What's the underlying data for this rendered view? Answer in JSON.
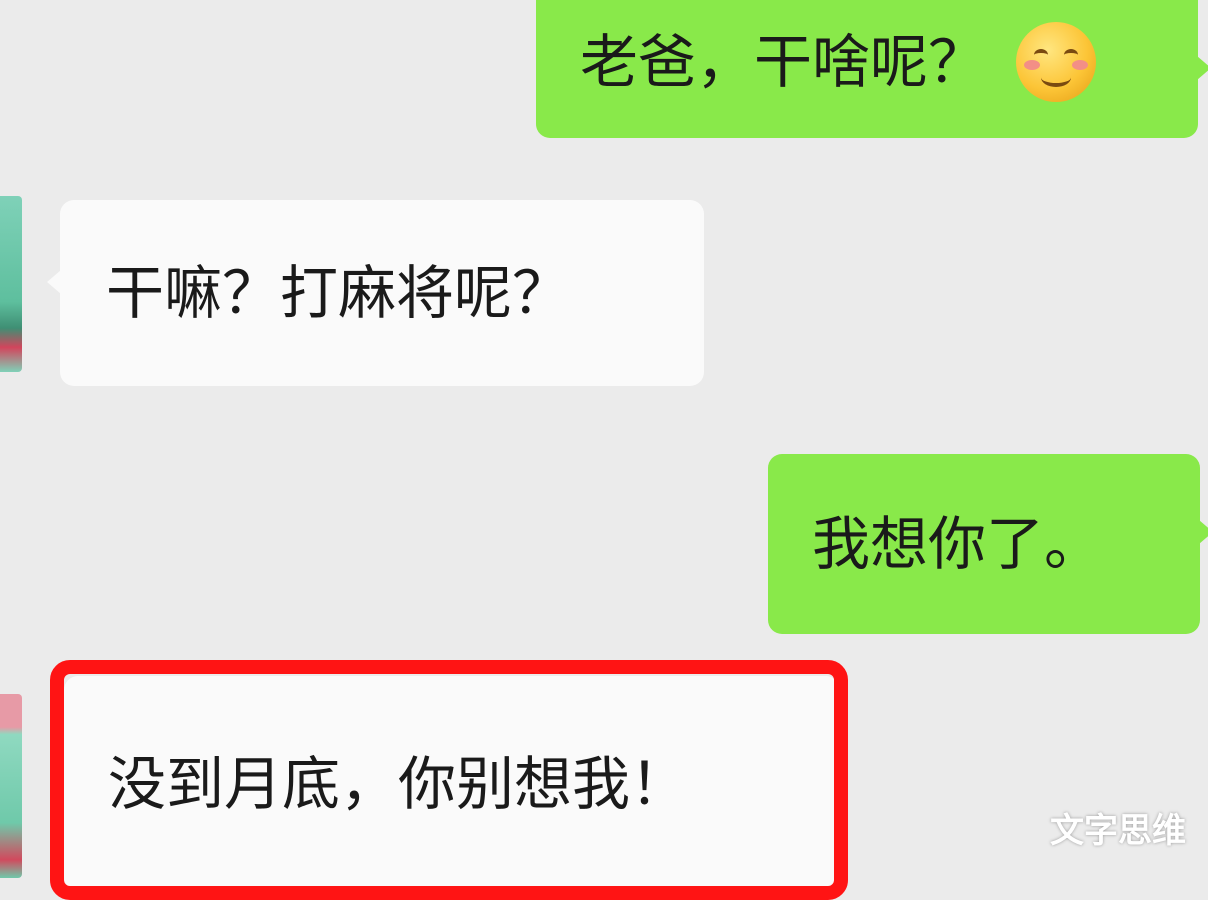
{
  "messages": [
    {
      "id": "msg-1",
      "direction": "outgoing",
      "text": "老爸，干啥呢？",
      "emoji": "smiling-face-emoji"
    },
    {
      "id": "msg-2",
      "direction": "incoming",
      "text": "干嘛？打麻将呢？"
    },
    {
      "id": "msg-3",
      "direction": "outgoing",
      "text": "我想你了。"
    },
    {
      "id": "msg-4",
      "direction": "incoming",
      "text": "没到月底，你别想我！",
      "highlighted": true
    }
  ],
  "watermark": "文字思维",
  "colors": {
    "outgoing_bubble": "#89e94a",
    "incoming_bubble": "#fafafa",
    "highlight_border": "#ff1414",
    "background": "#ebebeb"
  }
}
